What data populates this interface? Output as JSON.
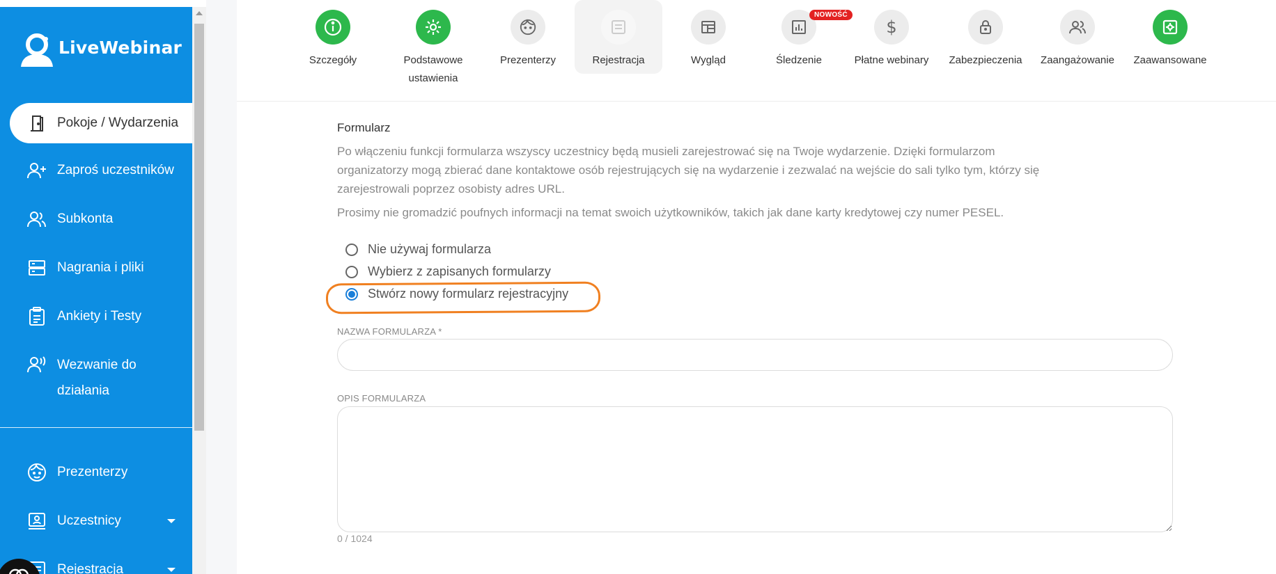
{
  "brand": {
    "name": "LiveWebinar"
  },
  "sidebar": {
    "items": [
      {
        "label": "Pokoje / Wydarzenia",
        "icon": "door-icon",
        "active": true
      },
      {
        "label": "Zaproś uczestników",
        "icon": "user-plus-icon"
      },
      {
        "label": "Subkonta",
        "icon": "users-icon"
      },
      {
        "label": "Nagrania i pliki",
        "icon": "server-icon"
      },
      {
        "label": "Ankiety i Testy",
        "icon": "clipboard-icon"
      },
      {
        "label": "Wezwanie do działania",
        "icon": "user-voice-icon"
      },
      {
        "label": "Prezenterzy",
        "icon": "presenter-face-icon"
      },
      {
        "label": "Uczestnicy",
        "icon": "participants-icon",
        "has_caret": true
      },
      {
        "label": "Rejestracja",
        "icon": "registration-icon",
        "has_caret": true
      }
    ]
  },
  "tabs": [
    {
      "label": "Szczegóły",
      "icon": "info-icon",
      "state": "complete"
    },
    {
      "label": "Podstawowe ustawienia",
      "icon": "gear-icon",
      "state": "complete"
    },
    {
      "label": "Prezenterzy",
      "icon": "presenter-face-icon"
    },
    {
      "label": "Rejestracja",
      "icon": "form-icon",
      "active": true
    },
    {
      "label": "Wygląd",
      "icon": "layout-icon"
    },
    {
      "label": "Śledzenie",
      "icon": "chart-icon",
      "badge": "NOWOŚĆ"
    },
    {
      "label": "Płatne webinary",
      "icon": "dollar-icon"
    },
    {
      "label": "Zabezpieczenia",
      "icon": "lock-icon"
    },
    {
      "label": "Zaangażowanie",
      "icon": "engagement-icon"
    },
    {
      "label": "Zaawansowane",
      "icon": "advanced-icon",
      "state": "complete"
    }
  ],
  "form": {
    "title": "Formularz",
    "description": "Po włączeniu funkcji formularza wszyscy uczestnicy będą musieli zarejestrować się na Twoje wydarzenie. Dzięki formularzom organizatorzy mogą zbierać dane kontaktowe osób rejestrujących się na wydarzenie i zezwalać na wejście do sali tylko tym, którzy się zarejestrowali poprzez osobisty adres URL.",
    "notice": "Prosimy nie gromadzić poufnych informacji na temat swoich użytkowników, takich jak dane karty kredytowej czy numer PESEL.",
    "options": [
      {
        "label": "Nie używaj formularza",
        "checked": false
      },
      {
        "label": "Wybierz z zapisanych formularzy",
        "checked": false
      },
      {
        "label": "Stwórz nowy formularz rejestracyjny",
        "checked": true
      }
    ],
    "name_label": "NAZWA FORMULARZA *",
    "name_value": "",
    "description_label": "OPIS FORMULARZA",
    "description_value": "",
    "counter": "0 / 1024"
  },
  "colors": {
    "sidebar": "#0d8ee2",
    "complete_tab": "#2db84c",
    "highlight": "#f08021",
    "badge": "#e32222",
    "radio_checked": "#1a7fd9"
  }
}
